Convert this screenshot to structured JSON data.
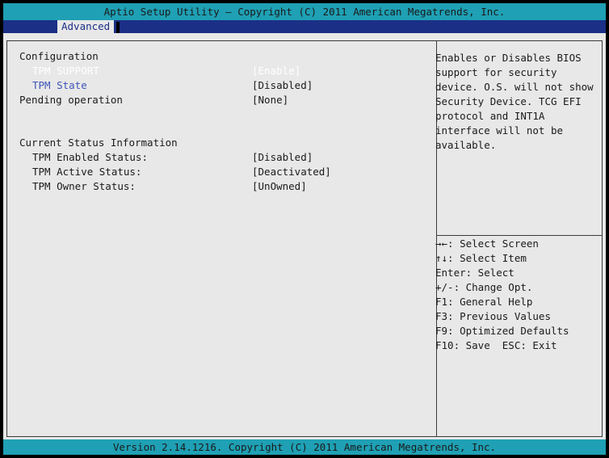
{
  "header": {
    "title": "Aptio Setup Utility – Copyright (C) 2011 American Megatrends, Inc."
  },
  "tabs": [
    {
      "label": "Advanced",
      "active": true
    }
  ],
  "settings": {
    "configuration_heading": "Configuration",
    "items": [
      {
        "label": "TPM SUPPORT",
        "value": "[Enable]"
      },
      {
        "label": "TPM State",
        "value": "[Disabled]"
      },
      {
        "label": "Pending operation",
        "value": "[None]"
      }
    ],
    "status_heading": "Current Status Information",
    "status": [
      {
        "label": "TPM Enabled Status:",
        "value": "[Disabled]"
      },
      {
        "label": "TPM Active Status:",
        "value": "[Deactivated]"
      },
      {
        "label": "TPM Owner Status:",
        "value": "[UnOwned]"
      }
    ]
  },
  "help": {
    "description": "Enables or Disables BIOS\nsupport for security\ndevice. O.S. will not show\nSecurity Device. TCG EFI\nprotocol and INT1A\ninterface will not be\navailable.",
    "keys": [
      "→←: Select Screen",
      "↑↓: Select Item",
      "Enter: Select",
      "+/-: Change Opt.",
      "F1: General Help",
      "F3: Previous Values",
      "F9: Optimized Defaults",
      "F10: Save  ESC: Exit"
    ]
  },
  "footer": {
    "version": "Version 2.14.1216. Copyright (C) 2011 American Megatrends, Inc."
  },
  "colors": {
    "header_bg": "#1fa0b4",
    "tab_bar_bg": "#1b2f86",
    "panel_bg": "#e8e8e8",
    "selected_item": "#ffffff",
    "selectable_item": "#3f55b8"
  }
}
